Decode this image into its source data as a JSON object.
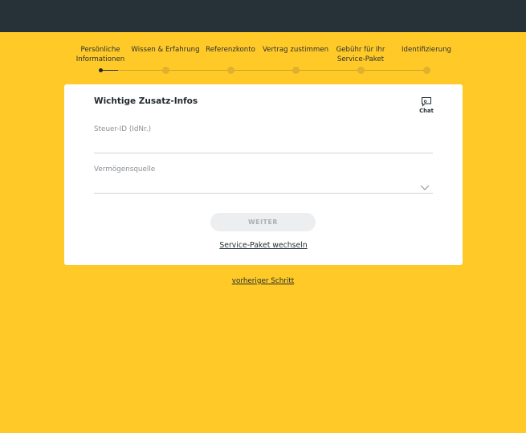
{
  "stepper": {
    "steps": [
      {
        "line1": "Persönliche",
        "line2": "Informationen"
      },
      {
        "line1": "Wissen & Erfahrung",
        "line2": ""
      },
      {
        "line1": "Referenzkonto",
        "line2": ""
      },
      {
        "line1": "Vertrag zustimmen",
        "line2": ""
      },
      {
        "line1": "Gebühr für Ihr",
        "line2": "Service-Paket"
      },
      {
        "line1": "Identifizierung",
        "line2": ""
      }
    ],
    "current_step": 1,
    "total_steps": 6
  },
  "card": {
    "title": "Wichtige Zusatz-Infos",
    "chat_label": "Chat",
    "tax_id": {
      "label": "Steuer-ID (IdNr.)",
      "value": ""
    },
    "wealth_source": {
      "label": "Vermögensquelle",
      "value": ""
    },
    "next_button": "WEITER",
    "change_package_link": "Service-Paket wechseln"
  },
  "previous_step_link": "vorheriger Schritt",
  "colors": {
    "header": "#263238",
    "background": "#ffca28",
    "card": "#ffffff",
    "text": "#1f2a30",
    "disabled_button": "#eceeef"
  },
  "icons": {
    "chat": "chat-bubble-icon",
    "dropdown": "chevron-down-icon"
  }
}
